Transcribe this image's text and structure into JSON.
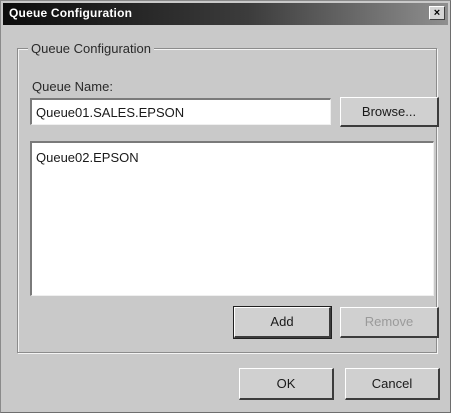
{
  "window": {
    "title": "Queue Configuration",
    "close_glyph": "×"
  },
  "group": {
    "legend": "Queue Configuration"
  },
  "queue_name": {
    "label": "Queue Name:",
    "value": "Queue01.SALES.EPSON"
  },
  "buttons": {
    "browse": "Browse...",
    "add": "Add",
    "remove": "Remove",
    "ok": "OK",
    "cancel": "Cancel"
  },
  "queue_list": {
    "items": [
      "Queue02.EPSON"
    ]
  },
  "colors": {
    "dialog_background": "#c9c9c9",
    "title_bar_start": "#0c0c0c",
    "title_bar_end": "#8f8f8f",
    "title_text": "#ffffff",
    "disabled_text": "#9a9a9a"
  },
  "icons": {
    "close": "close-icon"
  }
}
